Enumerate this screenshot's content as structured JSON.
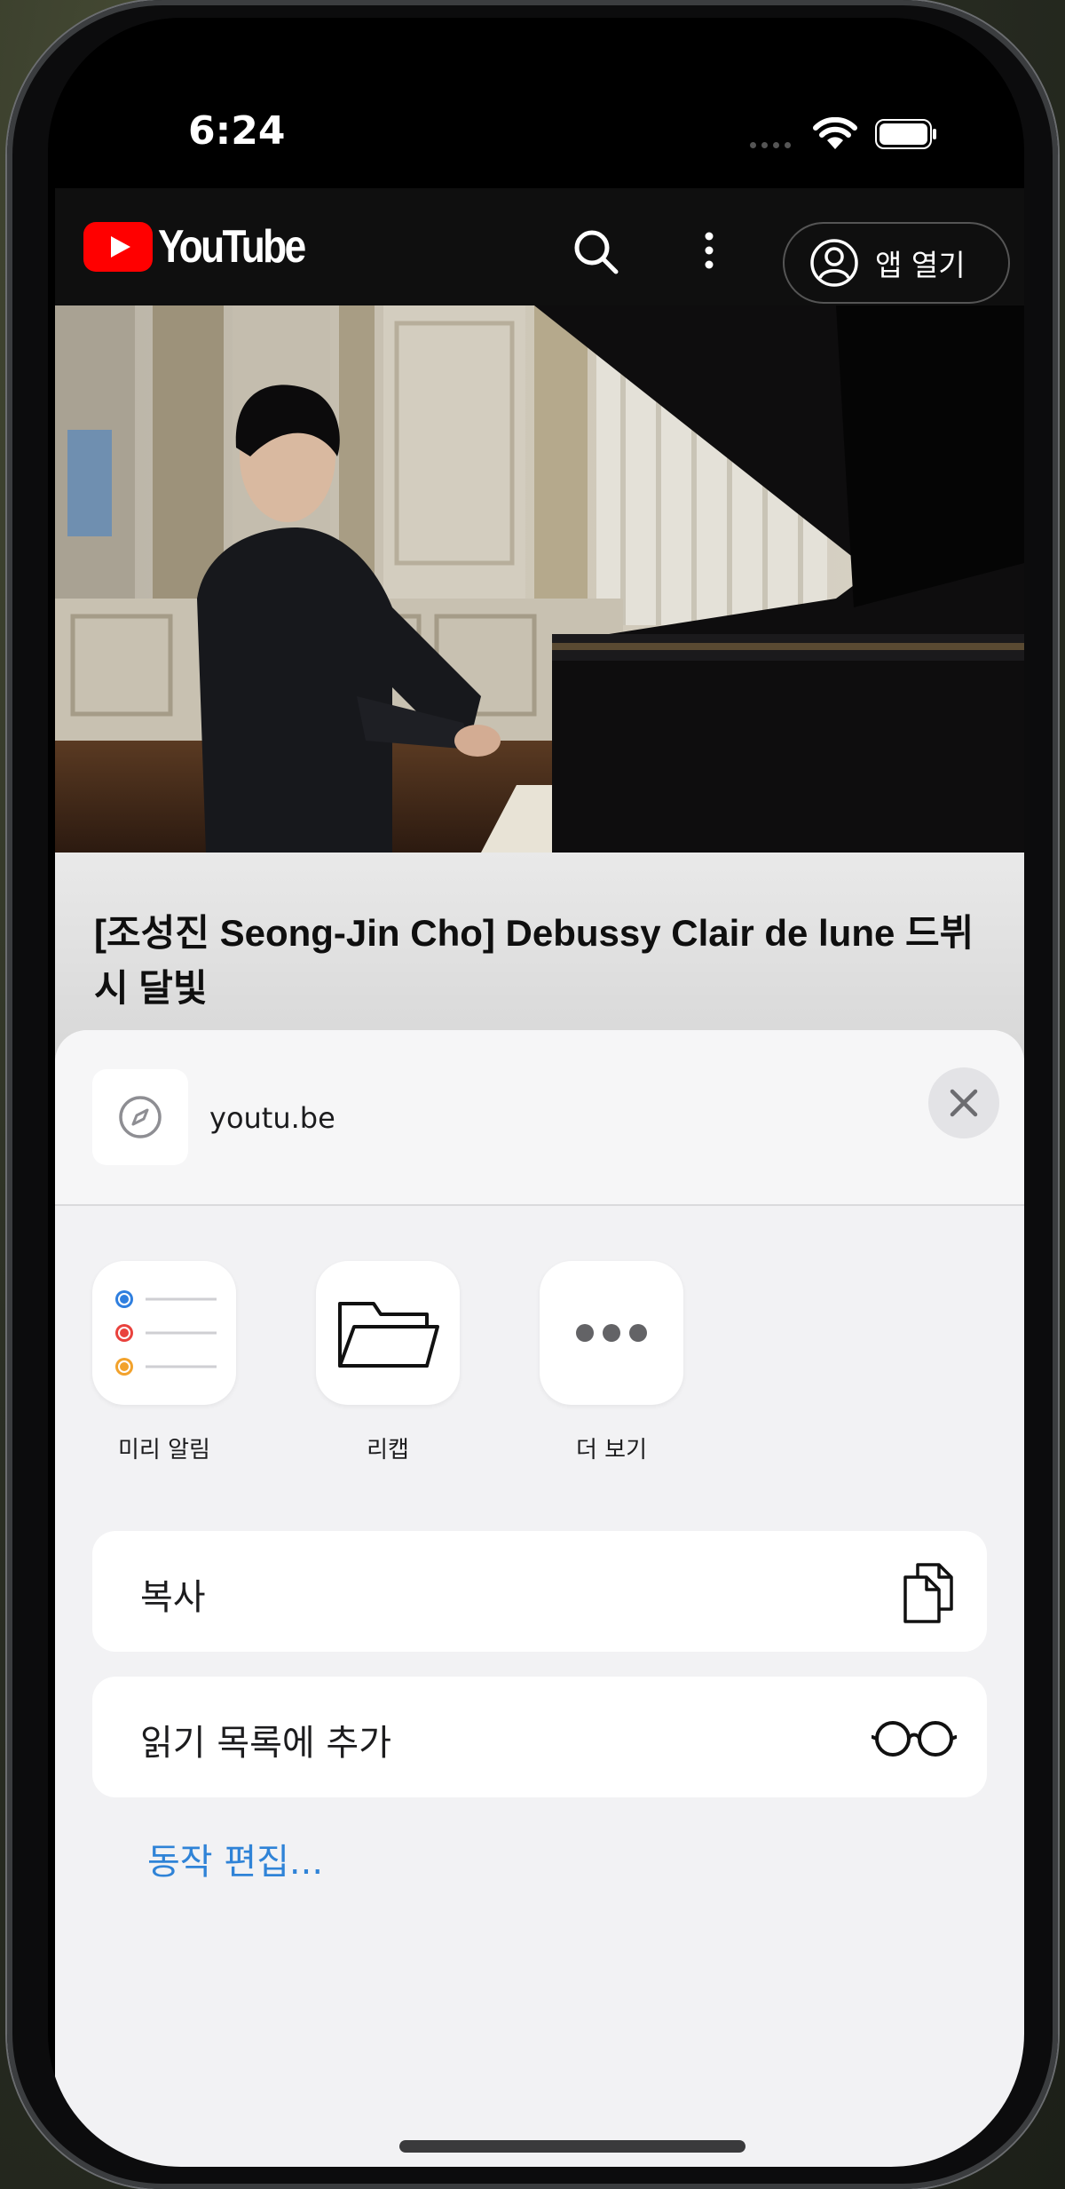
{
  "status_bar": {
    "time": "6:24"
  },
  "youtube": {
    "logo_text": "YouTube",
    "open_app_label": "앱 열기",
    "video_title": "[조성진 Seong-Jin Cho] Debussy Clair de lune 드뷔시 달빛"
  },
  "share_sheet": {
    "site": "youtu.be",
    "apps": [
      {
        "label": "미리 알림",
        "icon": "reminders-icon"
      },
      {
        "label": "리캡",
        "icon": "folder-icon"
      },
      {
        "label": "더 보기",
        "icon": "more-icon"
      }
    ],
    "actions": [
      {
        "label": "복사",
        "icon": "copy-icon"
      },
      {
        "label": "읽기 목록에 추가",
        "icon": "glasses-icon"
      }
    ],
    "edit_actions_label": "동작 편집..."
  },
  "colors": {
    "youtube_red": "#ff0000",
    "link_blue": "#2f83d7",
    "sheet_bg": "#f2f2f4"
  }
}
